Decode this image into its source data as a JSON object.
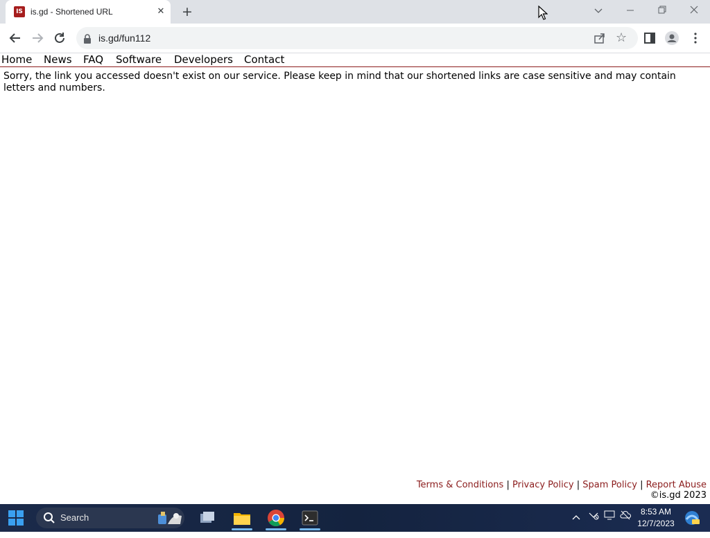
{
  "browser": {
    "tab": {
      "title": "is.gd - Shortened URL",
      "favicon_text": "IS"
    },
    "address": {
      "url": "is.gd/fun112"
    },
    "icons": {
      "back": "back-arrow-icon",
      "forward": "forward-arrow-icon",
      "reload": "reload-icon",
      "lock": "lock-icon",
      "share": "share-icon",
      "bookmark": "star-icon",
      "side_panel": "side-panel-icon",
      "profile": "profile-icon",
      "menu": "more-vert-icon"
    }
  },
  "site": {
    "nav": [
      "Home",
      "News",
      "FAQ",
      "Software",
      "Developers",
      "Contact"
    ],
    "message": "Sorry, the link you accessed doesn't exist on our service. Please keep in mind that our shortened links are case sensitive and may contain letters and numbers.",
    "footer": {
      "links": [
        "Terms & Conditions",
        "Privacy Policy",
        "Spam Policy",
        "Report Abuse"
      ],
      "separator": "|",
      "copyright": "©is.gd 2023"
    },
    "colors": {
      "accent": "#8b1c1c"
    }
  },
  "taskbar": {
    "search_label": "Search",
    "clock": {
      "time": "8:53 AM",
      "date": "12/7/2023"
    },
    "apps": [
      "task-view-icon",
      "file-explorer-icon",
      "chrome-icon",
      "terminal-icon"
    ],
    "tray": [
      "chevron-up-icon",
      "network-icon",
      "display-icon",
      "cloud-off-icon",
      "widgets-icon"
    ]
  }
}
